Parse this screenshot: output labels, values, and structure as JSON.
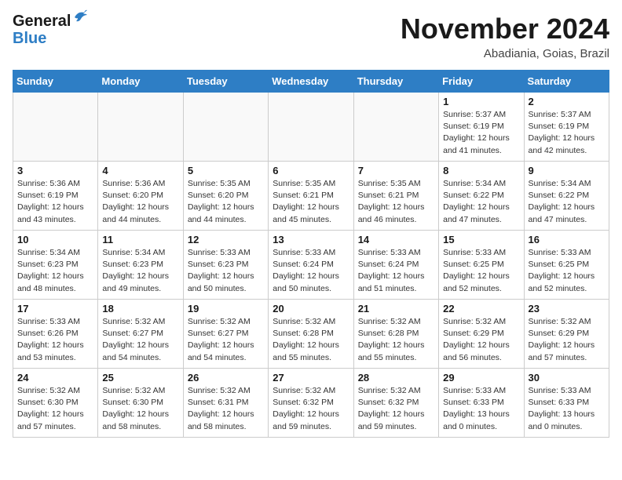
{
  "header": {
    "logo_general": "General",
    "logo_blue": "Blue",
    "month_title": "November 2024",
    "location": "Abadiania, Goias, Brazil"
  },
  "weekdays": [
    "Sunday",
    "Monday",
    "Tuesday",
    "Wednesday",
    "Thursday",
    "Friday",
    "Saturday"
  ],
  "weeks": [
    [
      {
        "day": "",
        "info": ""
      },
      {
        "day": "",
        "info": ""
      },
      {
        "day": "",
        "info": ""
      },
      {
        "day": "",
        "info": ""
      },
      {
        "day": "",
        "info": ""
      },
      {
        "day": "1",
        "info": "Sunrise: 5:37 AM\nSunset: 6:19 PM\nDaylight: 12 hours\nand 41 minutes."
      },
      {
        "day": "2",
        "info": "Sunrise: 5:37 AM\nSunset: 6:19 PM\nDaylight: 12 hours\nand 42 minutes."
      }
    ],
    [
      {
        "day": "3",
        "info": "Sunrise: 5:36 AM\nSunset: 6:19 PM\nDaylight: 12 hours\nand 43 minutes."
      },
      {
        "day": "4",
        "info": "Sunrise: 5:36 AM\nSunset: 6:20 PM\nDaylight: 12 hours\nand 44 minutes."
      },
      {
        "day": "5",
        "info": "Sunrise: 5:35 AM\nSunset: 6:20 PM\nDaylight: 12 hours\nand 44 minutes."
      },
      {
        "day": "6",
        "info": "Sunrise: 5:35 AM\nSunset: 6:21 PM\nDaylight: 12 hours\nand 45 minutes."
      },
      {
        "day": "7",
        "info": "Sunrise: 5:35 AM\nSunset: 6:21 PM\nDaylight: 12 hours\nand 46 minutes."
      },
      {
        "day": "8",
        "info": "Sunrise: 5:34 AM\nSunset: 6:22 PM\nDaylight: 12 hours\nand 47 minutes."
      },
      {
        "day": "9",
        "info": "Sunrise: 5:34 AM\nSunset: 6:22 PM\nDaylight: 12 hours\nand 47 minutes."
      }
    ],
    [
      {
        "day": "10",
        "info": "Sunrise: 5:34 AM\nSunset: 6:23 PM\nDaylight: 12 hours\nand 48 minutes."
      },
      {
        "day": "11",
        "info": "Sunrise: 5:34 AM\nSunset: 6:23 PM\nDaylight: 12 hours\nand 49 minutes."
      },
      {
        "day": "12",
        "info": "Sunrise: 5:33 AM\nSunset: 6:23 PM\nDaylight: 12 hours\nand 50 minutes."
      },
      {
        "day": "13",
        "info": "Sunrise: 5:33 AM\nSunset: 6:24 PM\nDaylight: 12 hours\nand 50 minutes."
      },
      {
        "day": "14",
        "info": "Sunrise: 5:33 AM\nSunset: 6:24 PM\nDaylight: 12 hours\nand 51 minutes."
      },
      {
        "day": "15",
        "info": "Sunrise: 5:33 AM\nSunset: 6:25 PM\nDaylight: 12 hours\nand 52 minutes."
      },
      {
        "day": "16",
        "info": "Sunrise: 5:33 AM\nSunset: 6:25 PM\nDaylight: 12 hours\nand 52 minutes."
      }
    ],
    [
      {
        "day": "17",
        "info": "Sunrise: 5:33 AM\nSunset: 6:26 PM\nDaylight: 12 hours\nand 53 minutes."
      },
      {
        "day": "18",
        "info": "Sunrise: 5:32 AM\nSunset: 6:27 PM\nDaylight: 12 hours\nand 54 minutes."
      },
      {
        "day": "19",
        "info": "Sunrise: 5:32 AM\nSunset: 6:27 PM\nDaylight: 12 hours\nand 54 minutes."
      },
      {
        "day": "20",
        "info": "Sunrise: 5:32 AM\nSunset: 6:28 PM\nDaylight: 12 hours\nand 55 minutes."
      },
      {
        "day": "21",
        "info": "Sunrise: 5:32 AM\nSunset: 6:28 PM\nDaylight: 12 hours\nand 55 minutes."
      },
      {
        "day": "22",
        "info": "Sunrise: 5:32 AM\nSunset: 6:29 PM\nDaylight: 12 hours\nand 56 minutes."
      },
      {
        "day": "23",
        "info": "Sunrise: 5:32 AM\nSunset: 6:29 PM\nDaylight: 12 hours\nand 57 minutes."
      }
    ],
    [
      {
        "day": "24",
        "info": "Sunrise: 5:32 AM\nSunset: 6:30 PM\nDaylight: 12 hours\nand 57 minutes."
      },
      {
        "day": "25",
        "info": "Sunrise: 5:32 AM\nSunset: 6:30 PM\nDaylight: 12 hours\nand 58 minutes."
      },
      {
        "day": "26",
        "info": "Sunrise: 5:32 AM\nSunset: 6:31 PM\nDaylight: 12 hours\nand 58 minutes."
      },
      {
        "day": "27",
        "info": "Sunrise: 5:32 AM\nSunset: 6:32 PM\nDaylight: 12 hours\nand 59 minutes."
      },
      {
        "day": "28",
        "info": "Sunrise: 5:32 AM\nSunset: 6:32 PM\nDaylight: 12 hours\nand 59 minutes."
      },
      {
        "day": "29",
        "info": "Sunrise: 5:33 AM\nSunset: 6:33 PM\nDaylight: 13 hours\nand 0 minutes."
      },
      {
        "day": "30",
        "info": "Sunrise: 5:33 AM\nSunset: 6:33 PM\nDaylight: 13 hours\nand 0 minutes."
      }
    ]
  ]
}
